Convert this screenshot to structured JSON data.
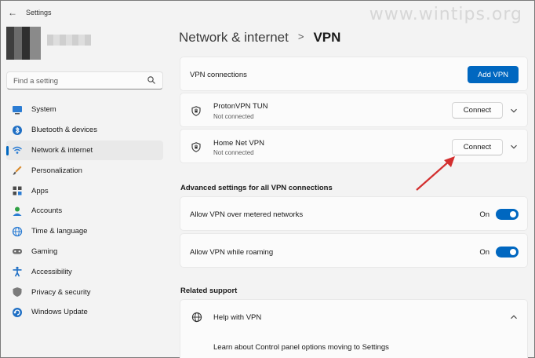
{
  "app": {
    "title": "Settings",
    "back_label": "←",
    "watermark": "www.wintips.org"
  },
  "search": {
    "placeholder": "Find a setting"
  },
  "sidebar": {
    "items": [
      {
        "label": "System",
        "icon": "monitor-icon"
      },
      {
        "label": "Bluetooth & devices",
        "icon": "bluetooth-icon"
      },
      {
        "label": "Network & internet",
        "icon": "wifi-icon",
        "active": true
      },
      {
        "label": "Personalization",
        "icon": "brush-icon"
      },
      {
        "label": "Apps",
        "icon": "apps-icon"
      },
      {
        "label": "Accounts",
        "icon": "person-icon"
      },
      {
        "label": "Time & language",
        "icon": "globe-clock-icon"
      },
      {
        "label": "Gaming",
        "icon": "gamepad-icon"
      },
      {
        "label": "Accessibility",
        "icon": "accessibility-icon"
      },
      {
        "label": "Privacy & security",
        "icon": "shield-icon"
      },
      {
        "label": "Windows Update",
        "icon": "update-icon"
      }
    ]
  },
  "breadcrumb": {
    "parent": "Network & internet",
    "separator": ">",
    "current": "VPN"
  },
  "vpn": {
    "header_label": "VPN connections",
    "add_button": "Add VPN",
    "connections": [
      {
        "name": "ProtonVPN TUN",
        "status": "Not connected",
        "button": "Connect"
      },
      {
        "name": "Home Net VPN",
        "status": "Not connected",
        "button": "Connect"
      }
    ]
  },
  "advanced": {
    "title": "Advanced settings for all VPN connections",
    "settings": [
      {
        "label": "Allow VPN over metered networks",
        "state": "On"
      },
      {
        "label": "Allow VPN while roaming",
        "state": "On"
      }
    ]
  },
  "related": {
    "title": "Related support",
    "help_label": "Help with VPN",
    "link": "Learn about Control panel options moving to Settings"
  },
  "colors": {
    "accent": "#0067c0",
    "annotation_arrow": "#d32f2f"
  }
}
